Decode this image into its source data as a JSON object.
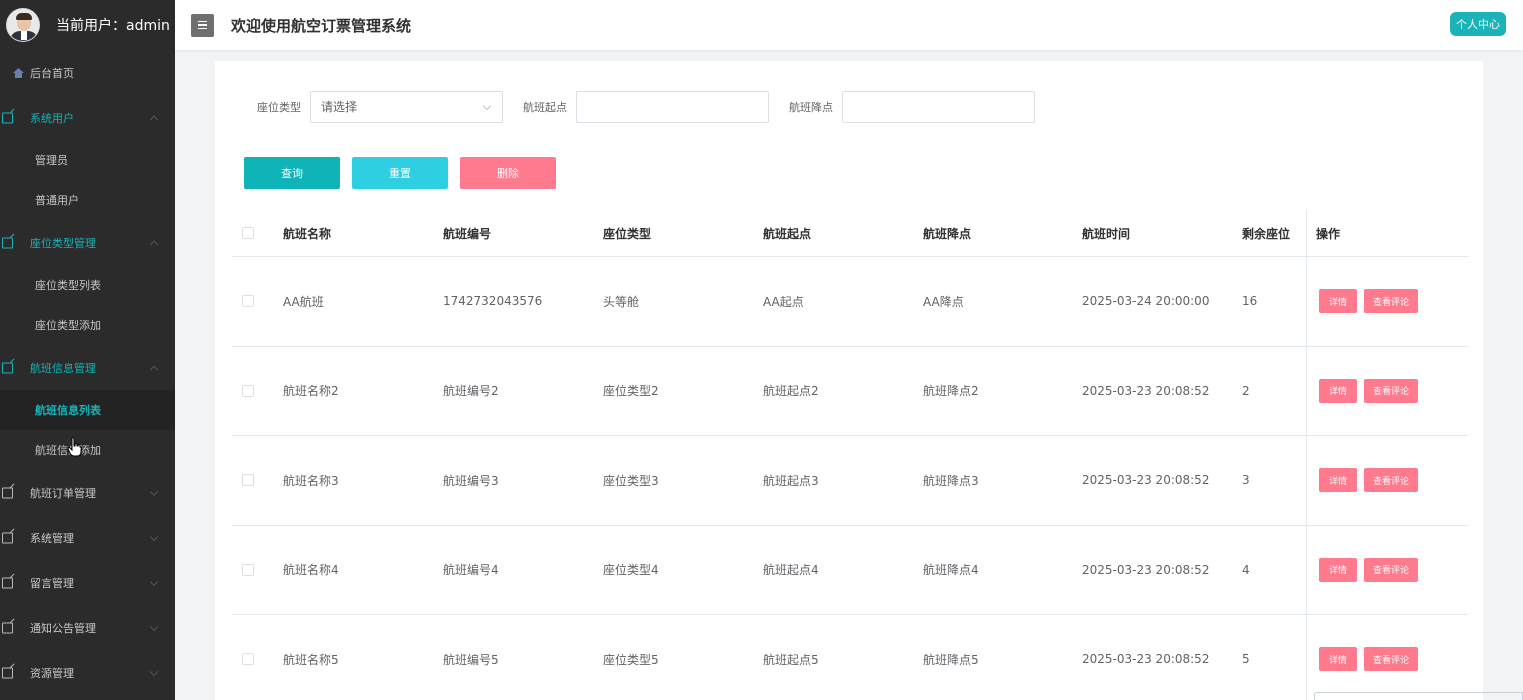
{
  "header": {
    "current_user": "当前用户：admin",
    "system_title": "欢迎使用航空订票管理系统",
    "personal_center": "个人中心"
  },
  "sidebar": {
    "home": "后台首页",
    "groups": [
      {
        "label": "系统用户",
        "expanded": true,
        "children": [
          "管理员",
          "普通用户"
        ]
      },
      {
        "label": "座位类型管理",
        "expanded": true,
        "children": [
          "座位类型列表",
          "座位类型添加"
        ]
      },
      {
        "label": "航班信息管理",
        "expanded": true,
        "children": [
          "航班信息列表",
          "航班信息添加"
        ]
      },
      {
        "label": "航班订单管理",
        "expanded": false,
        "children": []
      },
      {
        "label": "系统管理",
        "expanded": false,
        "children": []
      },
      {
        "label": "留言管理",
        "expanded": false,
        "children": []
      },
      {
        "label": "通知公告管理",
        "expanded": false,
        "children": []
      },
      {
        "label": "资源管理",
        "expanded": false,
        "children": []
      }
    ],
    "active_item": "航班信息列表"
  },
  "search": {
    "seat_type_label": "座位类型",
    "seat_type_placeholder": "请选择",
    "origin_label": "航班起点",
    "origin_value": "",
    "destination_label": "航班降点",
    "destination_value": ""
  },
  "buttons": {
    "query": "查询",
    "reset": "重置",
    "delete": "删除"
  },
  "table": {
    "columns": [
      "航班名称",
      "航班编号",
      "座位类型",
      "航班起点",
      "航班降点",
      "航班时间",
      "剩余座位",
      "操作"
    ],
    "rows": [
      {
        "name": "AA航班",
        "code": "1742732043576",
        "seat_type": "头等舱",
        "origin": "AA起点",
        "destination": "AA降点",
        "time": "2025-03-24 20:00:00",
        "remaining": "16"
      },
      {
        "name": "航班名称2",
        "code": "航班编号2",
        "seat_type": "座位类型2",
        "origin": "航班起点2",
        "destination": "航班降点2",
        "time": "2025-03-23 20:08:52",
        "remaining": "2"
      },
      {
        "name": "航班名称3",
        "code": "航班编号3",
        "seat_type": "座位类型3",
        "origin": "航班起点3",
        "destination": "航班降点3",
        "time": "2025-03-23 20:08:52",
        "remaining": "3"
      },
      {
        "name": "航班名称4",
        "code": "航班编号4",
        "seat_type": "座位类型4",
        "origin": "航班起点4",
        "destination": "航班降点4",
        "time": "2025-03-23 20:08:52",
        "remaining": "4"
      },
      {
        "name": "航班名称5",
        "code": "航班编号5",
        "seat_type": "座位类型5",
        "origin": "航班起点5",
        "destination": "航班降点5",
        "time": "2025-03-23 20:08:52",
        "remaining": "5"
      }
    ],
    "row_actions": {
      "detail": "详情",
      "review": "查看评论"
    }
  },
  "colors": {
    "accent": "#1ab3b7",
    "sidebar_bg": "#2b2b2b",
    "danger": "#ff7a8d",
    "reset": "#2dcfe0"
  },
  "icons": [
    "avatar",
    "home-icon",
    "edit-icon",
    "chevron-icon",
    "menu-toggle-icon",
    "hand-cursor-icon"
  ]
}
